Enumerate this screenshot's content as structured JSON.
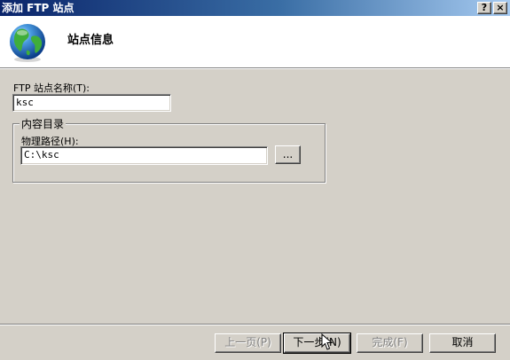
{
  "window": {
    "title": "添加 FTP 站点",
    "help_button": "?",
    "close_button": "×"
  },
  "header": {
    "title": "站点信息",
    "icon": "globe-icon"
  },
  "form": {
    "site_name_label": "FTP 站点名称(T):",
    "site_name_value": "ksc",
    "content_group_label": "内容目录",
    "physical_path_label": "物理路径(H):",
    "physical_path_value": "C:\\ksc",
    "browse_label": "..."
  },
  "buttons": {
    "prev": "上一页(P)",
    "next": "下一步(N)",
    "finish": "完成(F)",
    "cancel": "取消"
  },
  "colors": {
    "titlebar_start": "#0a246a",
    "titlebar_end": "#a6caf0",
    "dialog_bg": "#d4d0c8"
  }
}
